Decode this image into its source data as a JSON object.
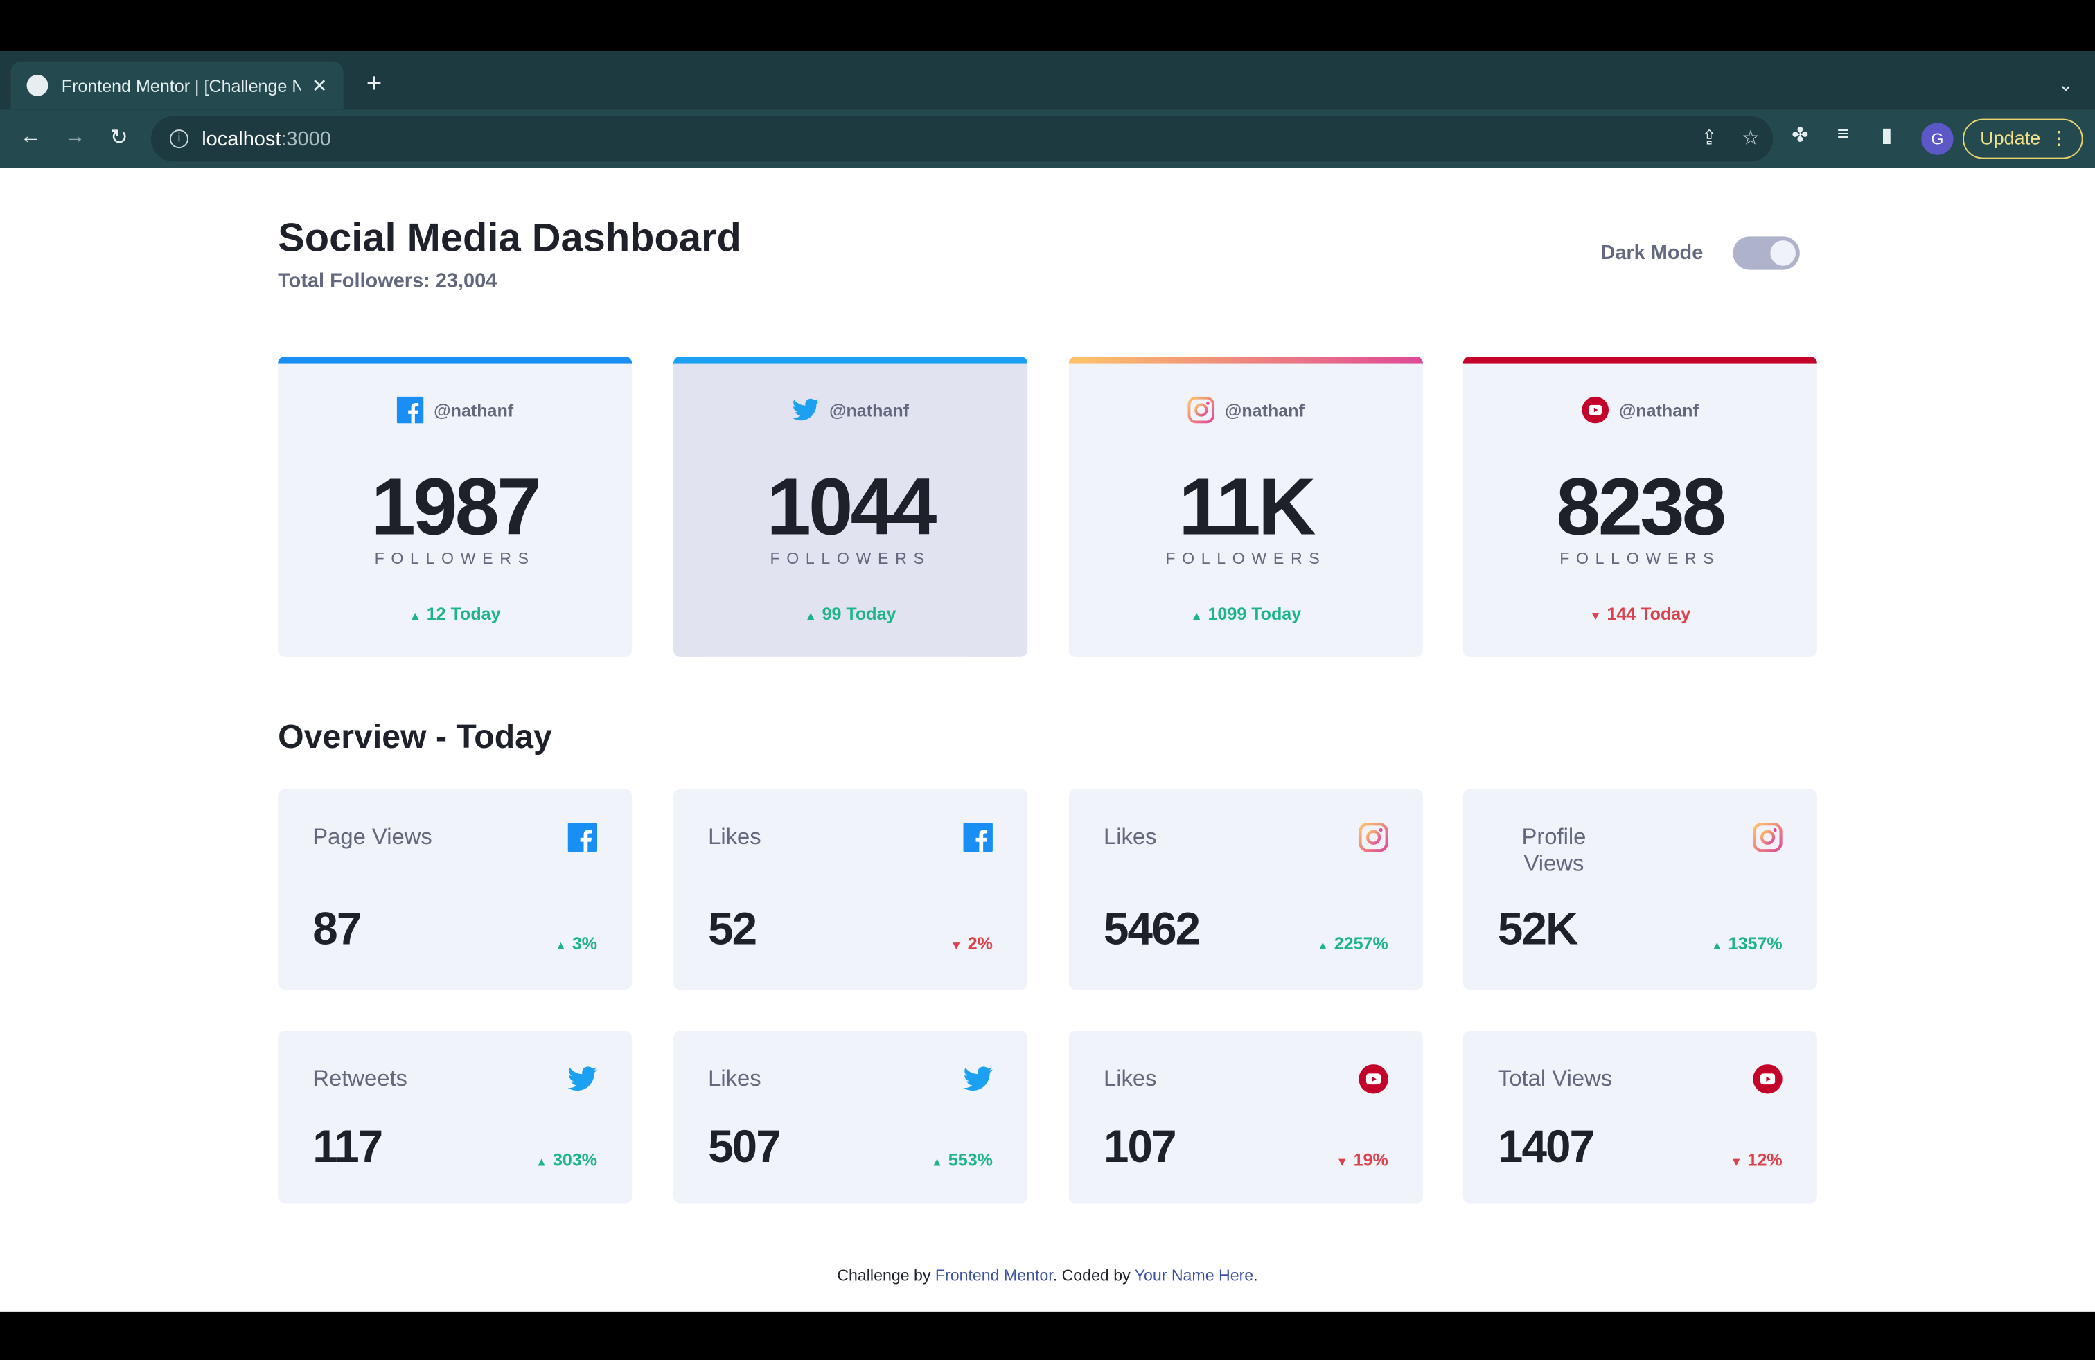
{
  "browser": {
    "tab_title": "Frontend Mentor | [Challenge N",
    "url_host": "localhost",
    "url_port": ":3000",
    "profile_initial": "G",
    "update_label": "Update"
  },
  "header": {
    "title": "Social Media Dashboard",
    "total_followers": "Total Followers: 23,004",
    "dark_mode_label": "Dark Mode"
  },
  "followers": [
    {
      "platform": "facebook",
      "handle": "@nathanf",
      "count": "1987",
      "label": "FOLLOWERS",
      "today": "12 Today",
      "trend": "up",
      "stripe": "#198ff5"
    },
    {
      "platform": "twitter",
      "handle": "@nathanf",
      "count": "1044",
      "label": "FOLLOWERS",
      "today": "99 Today",
      "trend": "up",
      "stripe": "#1ca0f2"
    },
    {
      "platform": "instagram",
      "handle": "@nathanf",
      "count": "11K",
      "label": "FOLLOWERS",
      "today": "1099 Today",
      "trend": "up",
      "stripe": "linear-gradient(to right,#fdc468,#df4996)"
    },
    {
      "platform": "youtube",
      "handle": "@nathanf",
      "count": "8238",
      "label": "FOLLOWERS",
      "today": "144 Today",
      "trend": "down",
      "stripe": "#c4032a"
    }
  ],
  "overview": {
    "title": "Overview - Today",
    "items": [
      {
        "label": "Page Views",
        "platform": "facebook",
        "value": "87",
        "pct": "3%",
        "trend": "up"
      },
      {
        "label": "Likes",
        "platform": "facebook",
        "value": "52",
        "pct": "2%",
        "trend": "down"
      },
      {
        "label": "Likes",
        "platform": "instagram",
        "value": "5462",
        "pct": "2257%",
        "trend": "up"
      },
      {
        "label": "Profile Views",
        "platform": "instagram",
        "value": "52K",
        "pct": "1357%",
        "trend": "up"
      },
      {
        "label": "Retweets",
        "platform": "twitter",
        "value": "117",
        "pct": "303%",
        "trend": "up"
      },
      {
        "label": "Likes",
        "platform": "twitter",
        "value": "507",
        "pct": "553%",
        "trend": "up"
      },
      {
        "label": "Likes",
        "platform": "youtube",
        "value": "107",
        "pct": "19%",
        "trend": "down"
      },
      {
        "label": "Total Views",
        "platform": "youtube",
        "value": "1407",
        "pct": "12%",
        "trend": "down"
      }
    ]
  },
  "footer": {
    "prefix": "Challenge by ",
    "link1": "Frontend Mentor",
    "middle": ". Coded by ",
    "link2": "Your Name Here",
    "suffix": "."
  },
  "colors": {
    "up": "#1db489",
    "down": "#dc414c",
    "facebook": "#198ff5",
    "twitter": "#1ca0f2",
    "youtube": "#c4032a"
  }
}
